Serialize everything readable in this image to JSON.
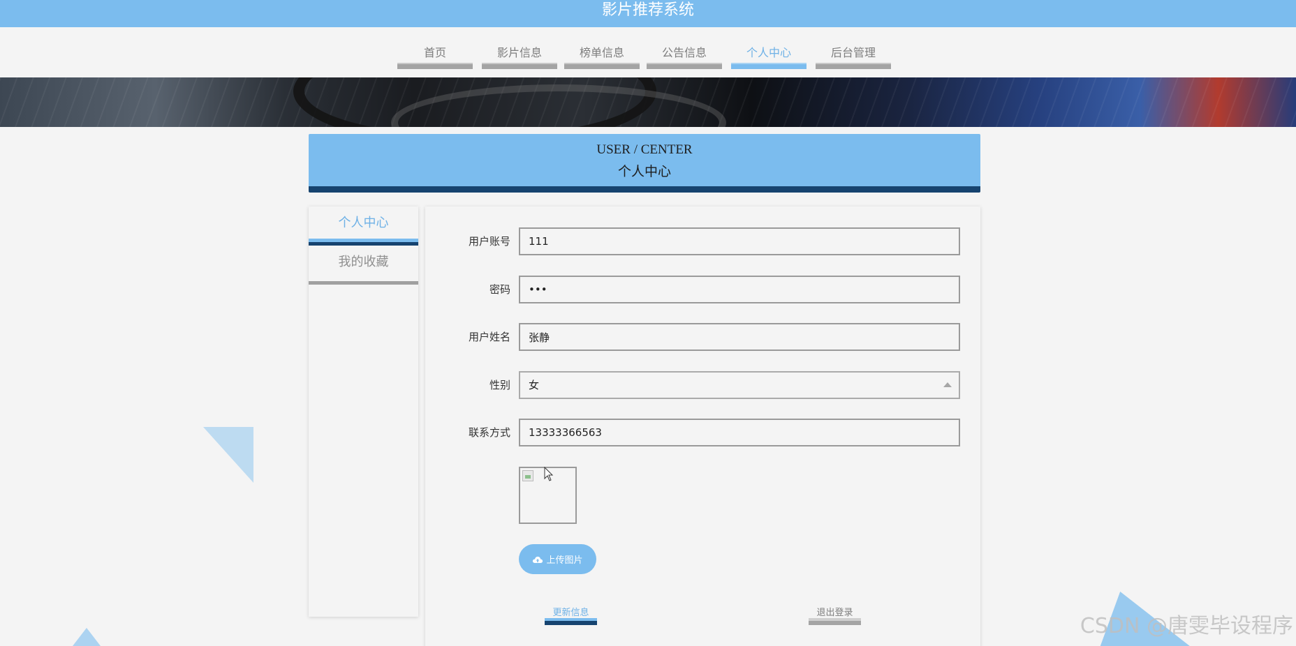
{
  "app": {
    "title": "影片推荐系统"
  },
  "nav": {
    "items": [
      {
        "label": "首页"
      },
      {
        "label": "影片信息"
      },
      {
        "label": "榜单信息"
      },
      {
        "label": "公告信息"
      },
      {
        "label": "个人中心"
      },
      {
        "label": "后台管理"
      }
    ],
    "active": "个人中心"
  },
  "section": {
    "en": "USER / CENTER",
    "cn": "个人中心"
  },
  "side_menu": {
    "items": [
      {
        "label": "个人中心"
      },
      {
        "label": "我的收藏"
      }
    ],
    "active": "个人中心"
  },
  "form": {
    "username": {
      "label": "用户账号",
      "value": "111"
    },
    "password": {
      "label": "密码",
      "value": "•••"
    },
    "name": {
      "label": "用户姓名",
      "value": "张静"
    },
    "gender": {
      "label": "性别",
      "value": "女"
    },
    "phone": {
      "label": "联系方式",
      "value": "13333366563"
    },
    "upload_label": "上传图片"
  },
  "actions": {
    "update": "更新信息",
    "logout": "退出登录"
  },
  "watermark": "CSDN @唐雯毕设程序",
  "colors": {
    "accent": "#7bbcee",
    "dark_accent": "#16436f",
    "bar_gray": "#a4a4a4"
  }
}
